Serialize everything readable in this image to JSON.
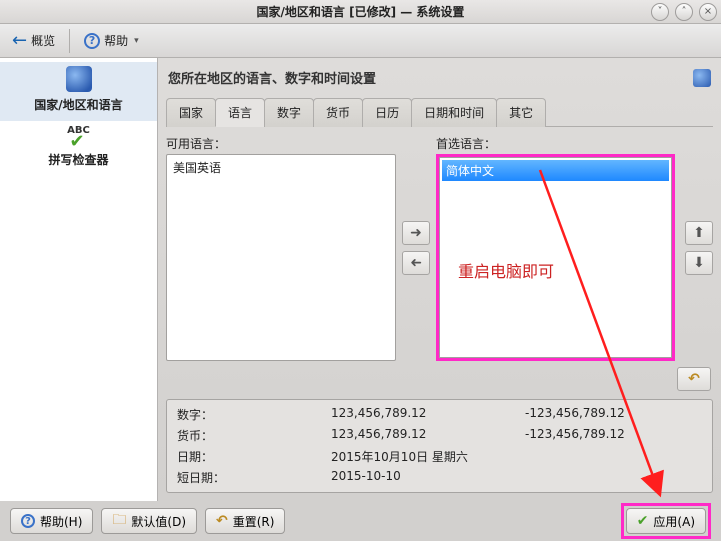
{
  "title": "国家/地区和语言 [已修改] — 系统设置",
  "toolbar": {
    "overview": "概览",
    "help": "帮助"
  },
  "sidebar": {
    "items": [
      {
        "label": "国家/地区和语言"
      },
      {
        "label": "拼写检查器"
      }
    ]
  },
  "main": {
    "heading": "您所在地区的语言、数字和时间设置",
    "tabs": [
      "国家",
      "语言",
      "数字",
      "货币",
      "日历",
      "日期和时间",
      "其它"
    ],
    "active_tab": 1,
    "available_label": "可用语言：",
    "preferred_label": "首选语言：",
    "available_items": [
      "美国英语"
    ],
    "preferred_items": [
      "简体中文"
    ],
    "annotation": "重启电脑即可",
    "info": {
      "rows": [
        {
          "label": "数字：",
          "v1": "123,456,789.12",
          "v2": "-123,456,789.12"
        },
        {
          "label": "货币：",
          "v1": "123,456,789.12",
          "v2": "-123,456,789.12"
        },
        {
          "label": "日期：",
          "v1": "2015年10月10日 星期六",
          "v2": ""
        },
        {
          "label": "短日期：",
          "v1": "2015-10-10",
          "v2": ""
        }
      ]
    }
  },
  "buttons": {
    "help": "帮助(H)",
    "defaults": "默认值(D)",
    "reset": "重置(R)",
    "apply": "应用(A)"
  }
}
